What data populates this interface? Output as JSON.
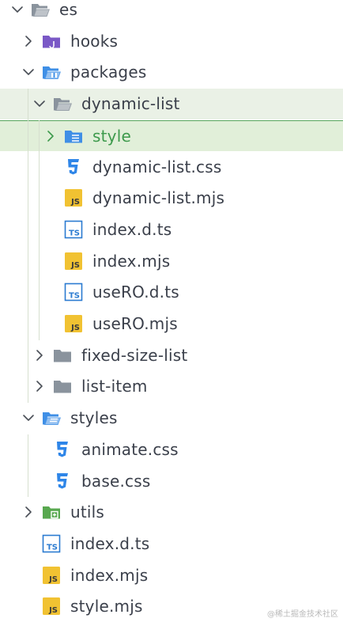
{
  "explorer": {
    "items": [
      {
        "id": "es",
        "label": "es",
        "type": "folder-open",
        "level": 0,
        "expanded": true
      },
      {
        "id": "hooks",
        "label": "hooks",
        "type": "folder-hooks",
        "level": 1,
        "expanded": false
      },
      {
        "id": "packages",
        "label": "packages",
        "type": "folder-packages",
        "level": 1,
        "expanded": true
      },
      {
        "id": "dynamic-list",
        "label": "dynamic-list",
        "type": "folder-open-gray",
        "level": 2,
        "expanded": true,
        "state": "hover"
      },
      {
        "id": "style",
        "label": "style",
        "type": "folder-style",
        "level": 3,
        "expanded": false,
        "state": "selected"
      },
      {
        "id": "dynamic-list-css",
        "label": "dynamic-list.css",
        "type": "css",
        "level": 3
      },
      {
        "id": "dynamic-list-mjs",
        "label": "dynamic-list.mjs",
        "type": "js",
        "level": 3
      },
      {
        "id": "index-dts-1",
        "label": "index.d.ts",
        "type": "ts",
        "level": 3
      },
      {
        "id": "index-mjs-1",
        "label": "index.mjs",
        "type": "js",
        "level": 3
      },
      {
        "id": "usero-dts",
        "label": "useRO.d.ts",
        "type": "ts",
        "level": 3
      },
      {
        "id": "usero-mjs",
        "label": "useRO.mjs",
        "type": "js",
        "level": 3
      },
      {
        "id": "fixed-size-list",
        "label": "fixed-size-list",
        "type": "folder-gray",
        "level": 2,
        "expanded": false
      },
      {
        "id": "list-item",
        "label": "list-item",
        "type": "folder-gray",
        "level": 2,
        "expanded": false
      },
      {
        "id": "styles",
        "label": "styles",
        "type": "folder-styles",
        "level": 1,
        "expanded": true
      },
      {
        "id": "animate-css",
        "label": "animate.css",
        "type": "css",
        "level": 2
      },
      {
        "id": "base-css",
        "label": "base.css",
        "type": "css",
        "level": 2
      },
      {
        "id": "utils",
        "label": "utils",
        "type": "folder-utils",
        "level": 1,
        "expanded": false
      },
      {
        "id": "index-dts-2",
        "label": "index.d.ts",
        "type": "ts",
        "level": 1
      },
      {
        "id": "index-mjs-2",
        "label": "index.mjs",
        "type": "js",
        "level": 1
      },
      {
        "id": "style-mjs",
        "label": "style.mjs",
        "type": "js",
        "level": 1
      }
    ]
  },
  "colors": {
    "selected_bg": "#e1efd9",
    "selected_border": "#54a35a",
    "selected_text": "#3d9a4c",
    "hover_bg": "#eaf1e6",
    "folder_gray": "#8a939d",
    "folder_blue": "#3f8fe6",
    "folder_purple": "#7a58c6",
    "folder_green": "#58a84f",
    "ts_blue": "#2b7bd1",
    "js_yellow": "#f1c232",
    "css_blue": "#2f86e8"
  },
  "watermark": "@稀土掘金技术社区"
}
